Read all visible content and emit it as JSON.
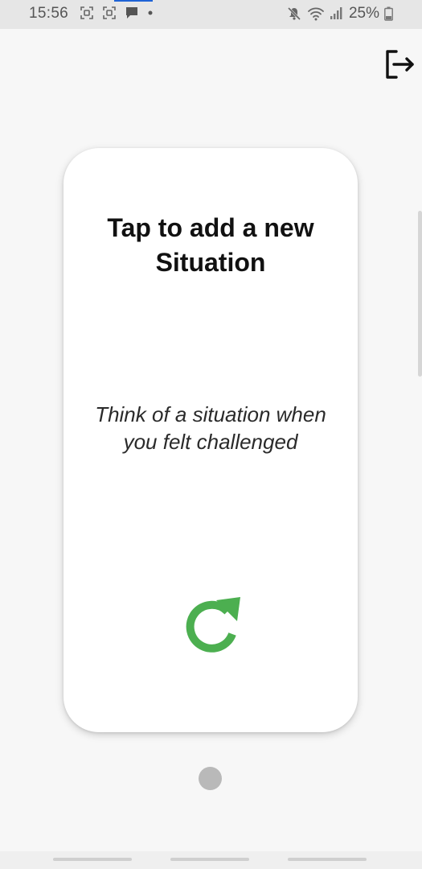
{
  "status_bar": {
    "time": "15:56",
    "battery_percent": "25%",
    "icons_left": [
      "screenshot-icon",
      "screenshot-icon",
      "message-icon",
      "dot-icon"
    ],
    "icons_right": [
      "mute-icon",
      "wifi-icon",
      "signal-icon",
      "battery-icon"
    ],
    "accent_color": "#1e63d6"
  },
  "toolbar": {
    "logout_icon": "logout-icon"
  },
  "card": {
    "title_lines": [
      "Tap to add a new",
      "Situation"
    ],
    "subtitle_lines": [
      "Think of a situation when",
      "you felt challenged"
    ],
    "refresh_icon": "refresh-icon",
    "refresh_color": "#4caf50"
  },
  "pager": {
    "current_page": 1,
    "total_pages": 1
  },
  "nav_bar": {
    "buttons": [
      "recent-apps",
      "home",
      "back"
    ]
  }
}
